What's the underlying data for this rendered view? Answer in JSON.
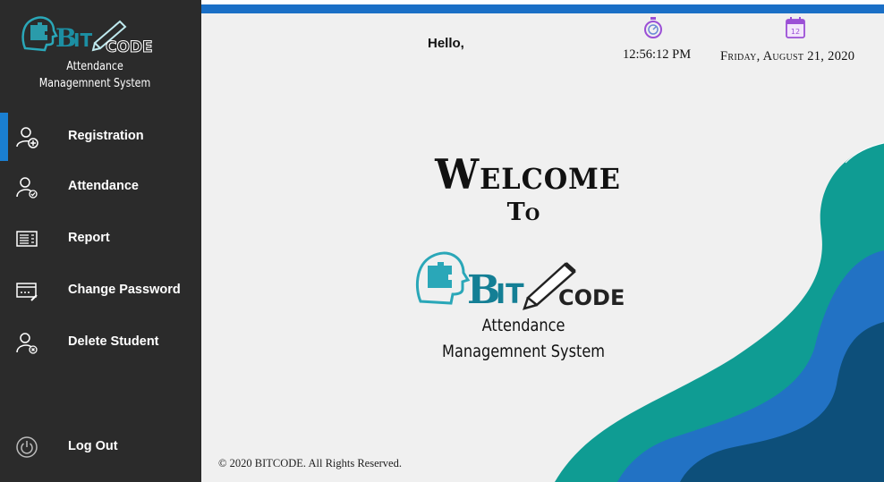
{
  "sidebar": {
    "logo": {
      "text_bit": "BIT",
      "text_code": "CODE"
    },
    "subtitle_line1": "Attendance",
    "subtitle_line2": "Managemnent System",
    "items": [
      {
        "label": "Registration",
        "icon": "user-add-icon",
        "active": true
      },
      {
        "label": "Attendance",
        "icon": "user-check-icon",
        "active": false
      },
      {
        "label": "Report",
        "icon": "report-icon",
        "active": false
      },
      {
        "label": "Change Password",
        "icon": "password-window-icon",
        "active": false
      },
      {
        "label": "Delete Student",
        "icon": "user-delete-icon",
        "active": false
      }
    ],
    "logout_label": "Log Out"
  },
  "header": {
    "greeting": "Hello,",
    "time": "12:56:12 PM",
    "date": "Friday, August 21, 2020",
    "calendar_day": "12"
  },
  "main": {
    "welcome": "Welcome",
    "to": "To",
    "logo": {
      "text_bit": "BIT",
      "text_code": "CODE"
    },
    "subtitle_line1": "Attendance",
    "subtitle_line2": "Managemnent System",
    "footer": "© 2020  BITCODE. All Rights Reserved."
  },
  "colors": {
    "sidebar_bg": "#2b2b2b",
    "accent_blue": "#1a7fd1",
    "teal": "#0f9c93",
    "dark_blue": "#0d4f7a",
    "mid_blue": "#2272c4"
  }
}
